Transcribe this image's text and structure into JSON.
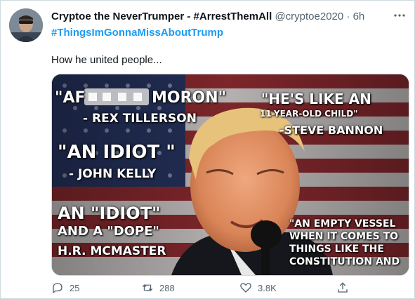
{
  "tweet": {
    "display_name": "Cryptoe the NeverTrumper - #ArrestThemAll",
    "handle": "@cryptoe2020",
    "separator": "·",
    "time": "6h",
    "hashtag": "#ThingsImGonnaMissAboutTrump",
    "text": "How he united people..."
  },
  "media": {
    "quote1_a": "\"AF",
    "quote1_b": "MORON\"",
    "attr1": "- REX TILLERSON",
    "quote2_a": "\"HE'S LIKE AN",
    "quote2_b": "11-YEAR-OLD CHILD\"",
    "attr2": "-STEVE BANNON",
    "quote3": "\"AN IDIOT \"",
    "attr3": "- JOHN KELLY",
    "quote4_a": "AN \"IDIOT\"",
    "quote4_b": "AND A \"DOPE\"",
    "attr4": "H.R. MCMASTER",
    "quote5_a": "\"AN EMPTY VESSEL",
    "quote5_b": "WHEN IT COMES TO",
    "quote5_c": "THINGS LIKE THE",
    "quote5_d": "CONSTITUTION AND"
  },
  "actions": {
    "replies": "25",
    "retweets": "288",
    "likes": "3.8K"
  },
  "icons": [
    "avatar",
    "more-icon",
    "reply-icon",
    "retweet-icon",
    "like-icon",
    "share-icon"
  ]
}
